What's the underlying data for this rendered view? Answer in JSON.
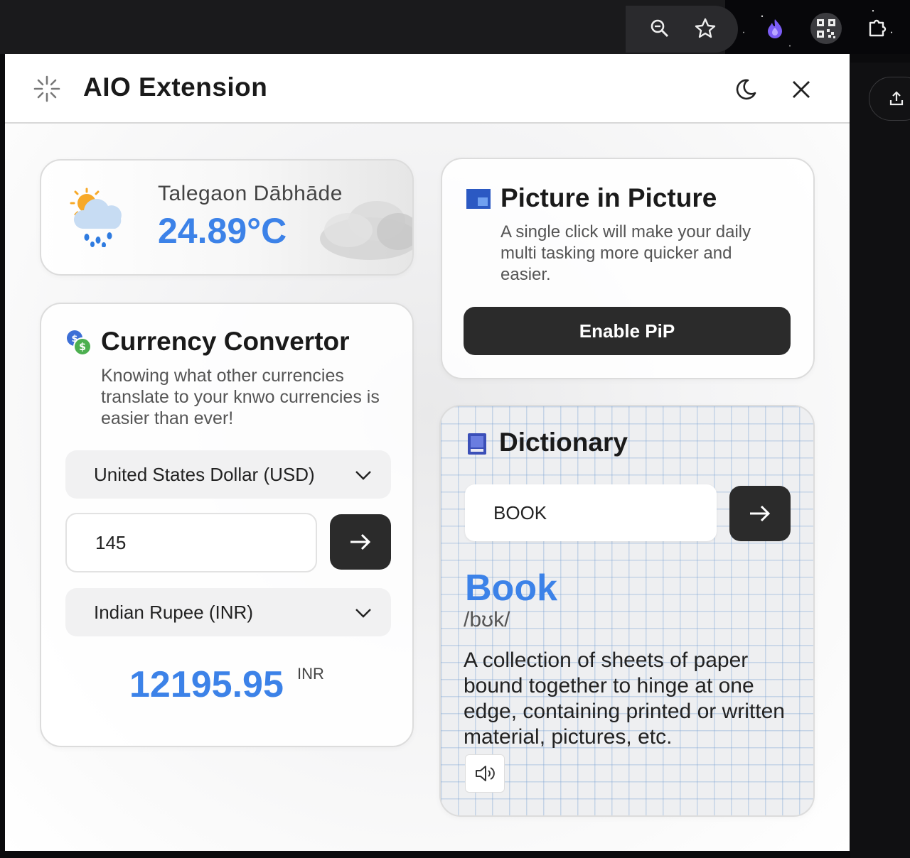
{
  "app": {
    "title": "AIO Extension"
  },
  "weather": {
    "city": "Talegaon Dābhāde",
    "temperature": "24.89°C"
  },
  "currency": {
    "title": "Currency Convertor",
    "description": "Knowing what other currencies translate to your knwo currencies is easier than ever!",
    "from_currency": "United States Dollar (USD)",
    "amount": "145",
    "to_currency": "Indian Rupee (INR)",
    "result": "12195.95",
    "result_unit": "INR"
  },
  "pip": {
    "title": "Picture in Picture",
    "description": "A single click will make your daily multi tasking more quicker and easier.",
    "button_label": "Enable PiP"
  },
  "dictionary": {
    "title": "Dictionary",
    "query": "BOOK",
    "word": "Book",
    "phonetic": "/bʊk/",
    "definition": "A collection of sheets of paper bound together to hinge at one edge, containing printed or written material, pictures, etc."
  },
  "colors": {
    "accent": "#3c82e8",
    "dark_button": "#2b2b2b",
    "card_border": "#dcdcdc"
  }
}
